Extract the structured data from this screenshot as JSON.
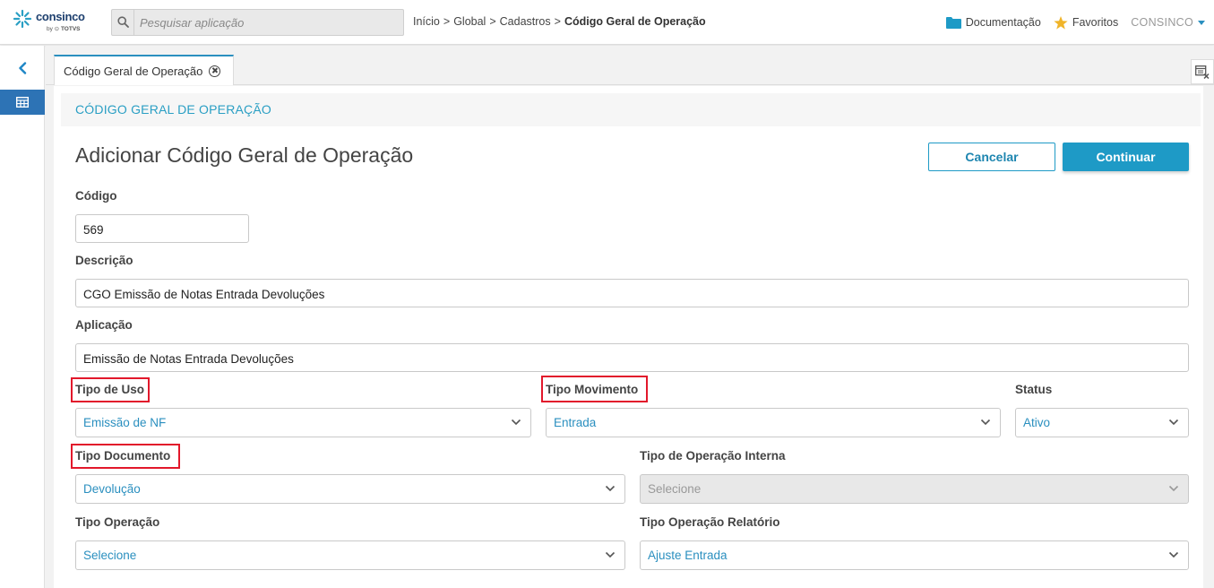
{
  "brand": {
    "name": "consinco",
    "by": "by",
    "sub": "TOTVS"
  },
  "search": {
    "placeholder": "Pesquisar aplicação"
  },
  "breadcrumb": [
    "Início",
    "Global",
    "Cadastros",
    "Código Geral de Operação"
  ],
  "breadcrumb_sep": ">",
  "topnav": {
    "documentation": "Documentação",
    "favorites": "Favoritos",
    "user": "CONSINCO"
  },
  "tab": {
    "label": "Código Geral de Operação"
  },
  "page": {
    "header": "CÓDIGO GERAL DE OPERAÇÃO",
    "title": "Adicionar Código Geral de Operação",
    "cancel": "Cancelar",
    "continue": "Continuar"
  },
  "form": {
    "codigo": {
      "label": "Código",
      "value": "569"
    },
    "descricao": {
      "label": "Descrição",
      "value": "CGO Emissão de Notas Entrada Devoluções"
    },
    "aplicacao": {
      "label": "Aplicação",
      "value": "Emissão de Notas Entrada Devoluções"
    },
    "tipo_uso": {
      "label": "Tipo de Uso",
      "value": "Emissão de NF"
    },
    "tipo_movimento": {
      "label": "Tipo Movimento",
      "value": "Entrada"
    },
    "status": {
      "label": "Status",
      "value": "Ativo"
    },
    "tipo_documento": {
      "label": "Tipo Documento",
      "value": "Devolução"
    },
    "tipo_operacao_interna": {
      "label": "Tipo de Operação Interna",
      "value": "Selecione"
    },
    "tipo_operacao": {
      "label": "Tipo Operação",
      "value": "Selecione"
    },
    "tipo_operacao_relatorio": {
      "label": "Tipo Operação Relatório",
      "value": "Ajuste Entrada"
    }
  },
  "colors": {
    "accent": "#1e9ac6",
    "highlight": "#e2182b",
    "sidebar_active": "#2d73b5"
  },
  "icons": [
    "search-icon",
    "folder-icon",
    "star-icon",
    "back-chevron-icon",
    "grid-icon",
    "close-circle-icon",
    "clear-tabs-icon",
    "chevron-down-icon"
  ]
}
